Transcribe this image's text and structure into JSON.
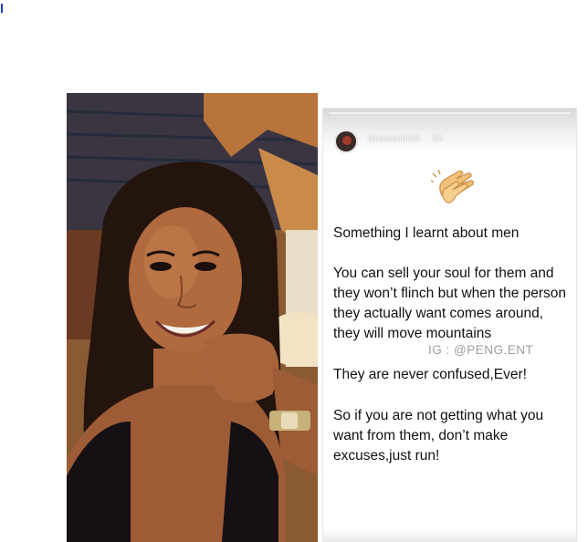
{
  "story": {
    "username": "omowunmiak",
    "time": "9h",
    "icon": "clapping-hands-emoji",
    "line1": "Something I learnt about men",
    "paragraph1": "You can sell your soul for them and they won’t flinch but when the person they actually want comes around, they will move mountains",
    "watermark": "IG : @PENG.ENT",
    "line2": "They are never confused,Ever!",
    "paragraph2": "So if you are not getting what you want from them, don’t make excuses,just run!"
  },
  "colors": {
    "text": "#111111",
    "watermark": "#9c9c9c",
    "cursor_mark": "#1d3fb8"
  }
}
